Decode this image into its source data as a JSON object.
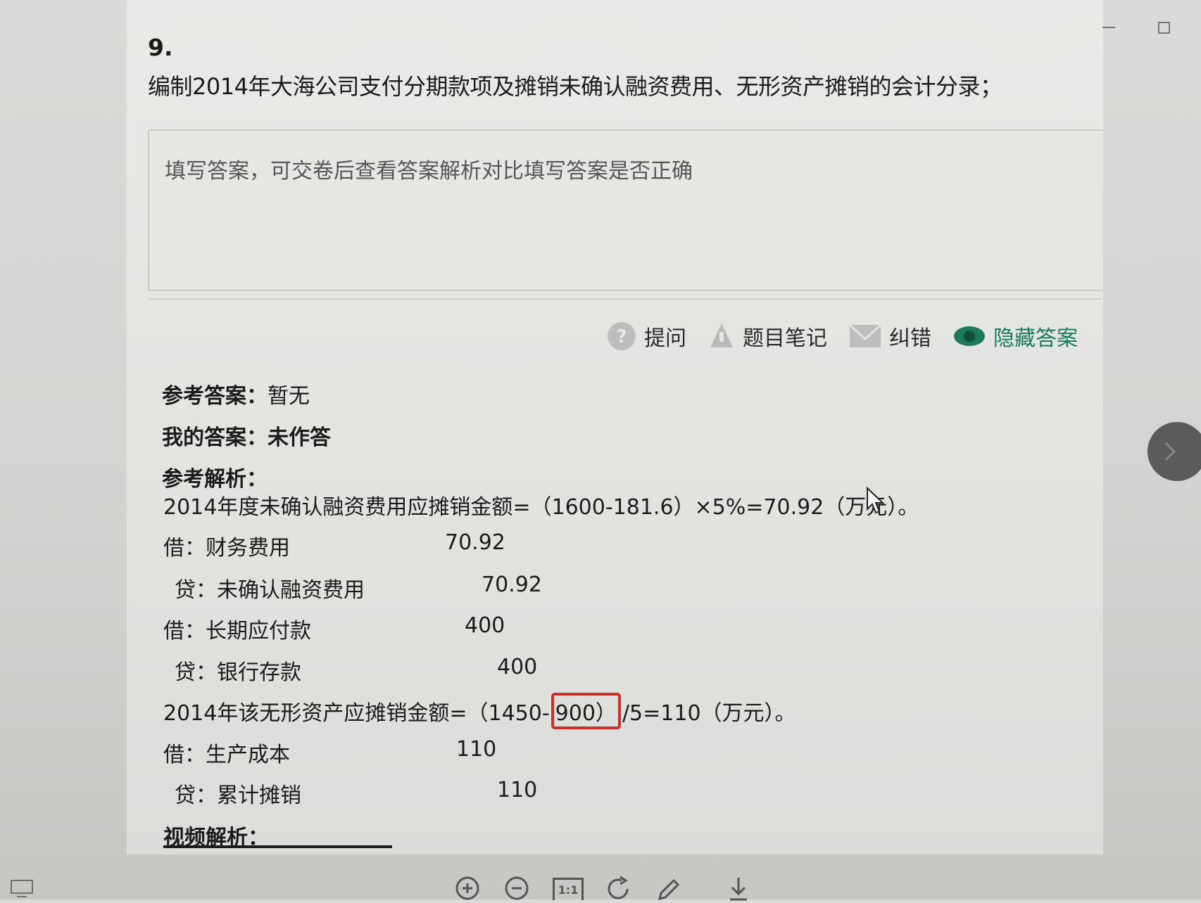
{
  "window": {
    "minimize_glyph": "—",
    "maximize_glyph": "□"
  },
  "question": {
    "number": "9.",
    "text": "编制2014年大海公司支付分期款项及摊销未确认融资费用、无形资产摊销的会计分录；"
  },
  "answer_box": {
    "placeholder": "填写答案，可交卷后查看答案解析对比填写答案是否正确"
  },
  "toolbar": {
    "ask_label": "提问",
    "notes_label": "题目笔记",
    "report_label": "纠错",
    "hide_answer_label": "隐藏答案",
    "accent_color": "#1a7a5a"
  },
  "reference": {
    "label": "参考答案：",
    "value": "暂无"
  },
  "my_answer": {
    "label": "我的答案：",
    "value": "未作答"
  },
  "analysis": {
    "label": "参考解析：",
    "line1": "2014年度未确认融资费用应摊销金额=（1600-181.6）×5%=70.92（万元）。",
    "entries1": [
      {
        "account": "借：财务费用",
        "amount": "70.92"
      },
      {
        "account": "贷：未确认融资费用",
        "amount": "70.92"
      },
      {
        "account": "借：长期应付款",
        "amount": "400"
      },
      {
        "account": "贷：银行存款",
        "amount": "400"
      }
    ],
    "line2_prefix": "2014年该无形资产应摊销金额=（1450-",
    "line2_highlight": "900）",
    "line2_suffix": "/5=110（万元）。",
    "highlight_color": "#c9302c",
    "entries2": [
      {
        "account": "借：生产成本",
        "amount": "110"
      },
      {
        "account": "贷：累计摊销",
        "amount": "110"
      }
    ]
  },
  "video": {
    "label": "视频解析："
  },
  "bottom_toolbar": {
    "icons": [
      "zoom-in-icon",
      "zoom-out-icon",
      "actual-size-icon",
      "rotate-icon",
      "pen-icon",
      "download-icon"
    ],
    "actual_size_label": "1:1"
  }
}
